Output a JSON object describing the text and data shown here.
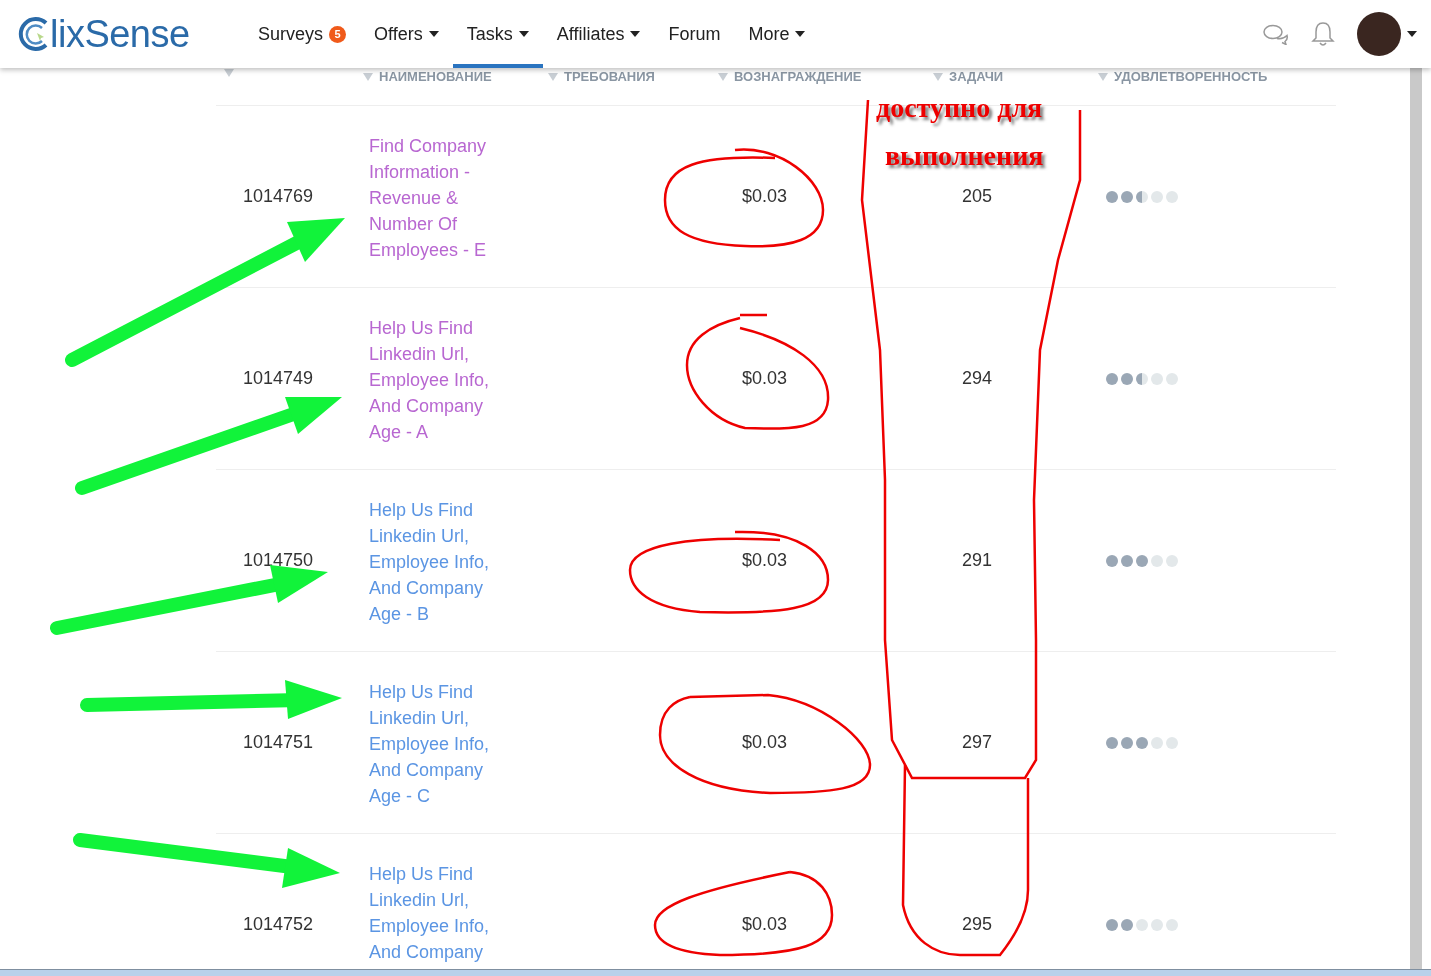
{
  "header": {
    "logo": "lixSense",
    "nav": [
      {
        "label": "Surveys",
        "badge": "5",
        "dropdown": false,
        "selected": false
      },
      {
        "label": "Offers",
        "dropdown": true,
        "selected": false
      },
      {
        "label": "Tasks",
        "dropdown": true,
        "selected": true
      },
      {
        "label": "Affiliates",
        "dropdown": true,
        "selected": false
      },
      {
        "label": "Forum",
        "dropdown": false,
        "selected": false
      },
      {
        "label": "More",
        "dropdown": true,
        "selected": false
      }
    ]
  },
  "table": {
    "columns": [
      "",
      "НАИМЕНОВАНИЕ",
      "ТРЕБОВАНИЯ",
      "ВОЗНАГРАЖДЕНИЕ",
      "ЗАДАЧИ",
      "УДОВЛЕТВОРЕННОСТЬ"
    ],
    "rows": [
      {
        "id": "1014769",
        "name": "Find Company Information - Revenue & Number Of Employees - E",
        "visited": true,
        "reward": "$0.03",
        "tasks": "205",
        "stars": 2.5
      },
      {
        "id": "1014749",
        "name": "Help Us Find Linkedin Url, Employee Info, And Company Age - A",
        "visited": true,
        "reward": "$0.03",
        "tasks": "294",
        "stars": 2.5
      },
      {
        "id": "1014750",
        "name": "Help Us Find Linkedin Url, Employee Info, And Company Age - B",
        "visited": false,
        "reward": "$0.03",
        "tasks": "291",
        "stars": 3
      },
      {
        "id": "1014751",
        "name": "Help Us Find Linkedin Url, Employee Info, And Company Age - C",
        "visited": false,
        "reward": "$0.03",
        "tasks": "297",
        "stars": 3
      },
      {
        "id": "1014752",
        "name": "Help Us Find Linkedin Url, Employee Info, And Company",
        "visited": false,
        "reward": "$0.03",
        "tasks": "295",
        "stars": 2
      }
    ]
  },
  "annotations": {
    "text": [
      "доступно для",
      "выполнения"
    ]
  }
}
